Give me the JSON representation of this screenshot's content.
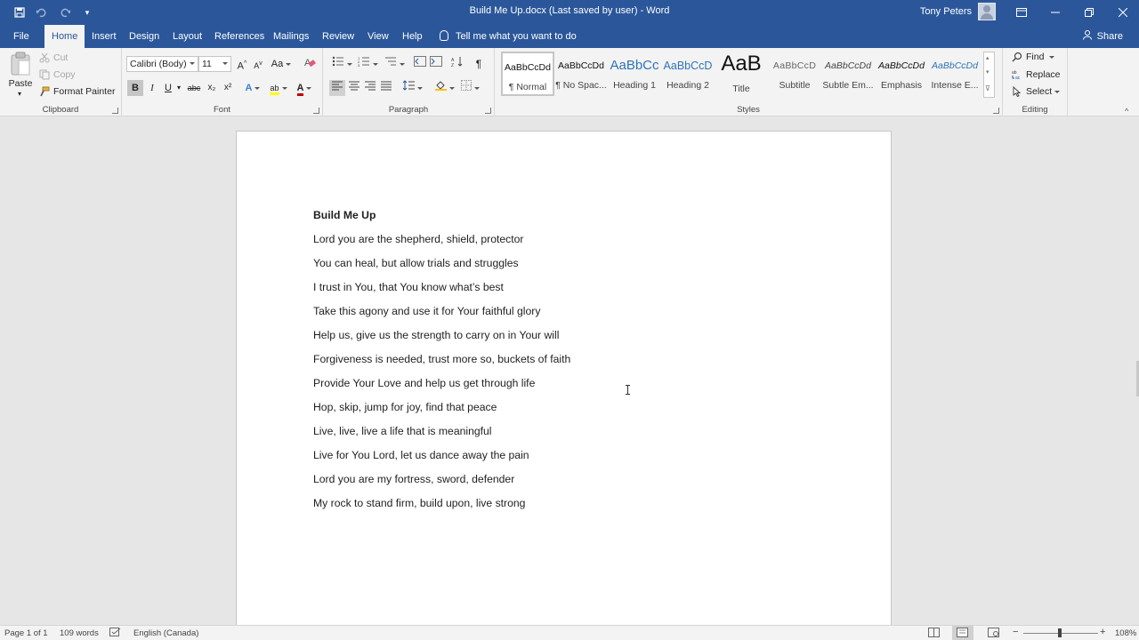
{
  "window": {
    "title": "Build Me Up.docx (Last saved by user)  -  Word",
    "user": "Tony Peters",
    "qa_icons": [
      "save-icon",
      "undo-icon",
      "redo-icon",
      "customize-icon"
    ],
    "controls": [
      "ribbon-display-icon",
      "minimize-icon",
      "restore-icon",
      "close-icon"
    ]
  },
  "tabs": [
    "File",
    "Home",
    "Insert",
    "Design",
    "Layout",
    "References",
    "Mailings",
    "Review",
    "View",
    "Help"
  ],
  "active_tab": "Home",
  "tell_me": "Tell me what you want to do",
  "share": "Share",
  "ribbon": {
    "clipboard": {
      "label": "Clipboard",
      "paste": "Paste",
      "cut": "Cut",
      "copy": "Copy",
      "format_painter": "Format Painter"
    },
    "font": {
      "label": "Font",
      "font_name": "Calibri (Body)",
      "font_size": "11",
      "bold": "B",
      "italic": "I",
      "underline": "U",
      "strike": "abc",
      "subscript": "x₂",
      "superscript": "x²",
      "grow": "A",
      "shrink": "A",
      "case": "Aa",
      "text_effects": "A",
      "highlight": "ab",
      "font_color": "A",
      "font_color_value": "#c00000",
      "highlight_color_value": "#ffff00"
    },
    "paragraph": {
      "label": "Paragraph",
      "pilcrow": "¶"
    },
    "styles": {
      "label": "Styles",
      "items": [
        {
          "preview": "AaBbCcDd",
          "name": "¶ Normal"
        },
        {
          "preview": "AaBbCcDd",
          "name": "¶ No Spac..."
        },
        {
          "preview": "AaBbCc",
          "name": "Heading 1"
        },
        {
          "preview": "AaBbCcD",
          "name": "Heading 2"
        },
        {
          "preview": "AaB",
          "name": "Title"
        },
        {
          "preview": "AaBbCcD",
          "name": "Subtitle"
        },
        {
          "preview": "AaBbCcDd",
          "name": "Subtle Em..."
        },
        {
          "preview": "AaBbCcDd",
          "name": "Emphasis"
        },
        {
          "preview": "AaBbCcDd",
          "name": "Intense E..."
        }
      ]
    },
    "editing": {
      "label": "Editing",
      "find": "Find",
      "replace": "Replace",
      "select": "Select"
    }
  },
  "document": {
    "title": "Build Me Up",
    "lines": [
      "Lord you are the shepherd, shield, protector",
      "You can heal, but allow trials and struggles",
      "I trust in You, that You know what’s best",
      "Take this agony and use it for Your faithful glory",
      "Help us, give us the strength to carry on in Your will",
      "Forgiveness is needed, trust more so, buckets of faith",
      "Provide Your Love and help us get through life",
      "Hop, skip, jump for joy, find that peace",
      "Live, live, live a life that is meaningful",
      "Live for You Lord, let us dance away the pain",
      "Lord you are my fortress, sword, defender",
      "My rock to stand firm, build upon, live strong"
    ]
  },
  "status": {
    "page": "Page 1 of 1",
    "words": "109 words",
    "language": "English (Canada)",
    "zoom": "108%",
    "zoom_minus": "−",
    "zoom_plus": "+"
  }
}
